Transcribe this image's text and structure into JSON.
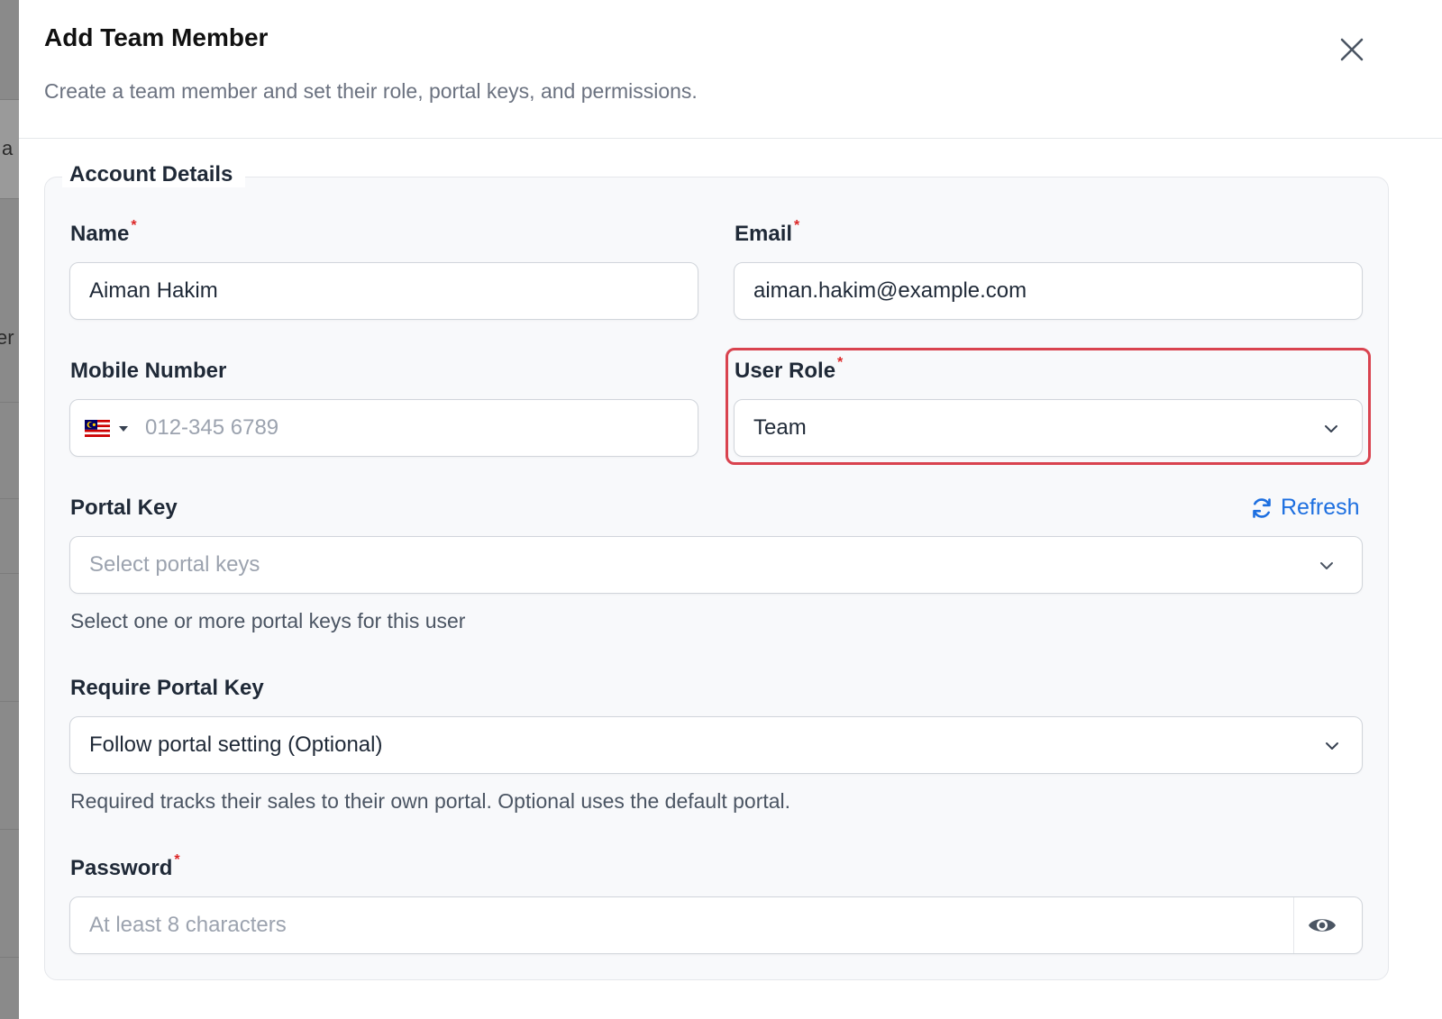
{
  "background": {
    "fragments": [
      "a",
      "er"
    ]
  },
  "modal": {
    "title": "Add Team Member",
    "subtitle": "Create a team member and set their role, portal keys, and permissions.",
    "close_icon": "close-icon"
  },
  "account_details": {
    "legend": "Account Details",
    "name": {
      "label": "Name",
      "required_mark": "*",
      "value": "Aiman Hakim"
    },
    "email": {
      "label": "Email",
      "required_mark": "*",
      "value": "aiman.hakim@example.com"
    },
    "mobile": {
      "label": "Mobile Number",
      "country_flag_icon": "malaysia-flag-icon",
      "placeholder": "012-345 6789"
    },
    "user_role": {
      "label": "User Role",
      "required_mark": "*",
      "selected": "Team",
      "highlight_color": "#d9434f"
    },
    "portal_key": {
      "label": "Portal Key",
      "refresh_label": "Refresh",
      "refresh_icon": "refresh-icon",
      "placeholder": "Select portal keys",
      "help": "Select one or more portal keys for this user"
    },
    "require_portal_key": {
      "label": "Require Portal Key",
      "selected": "Follow portal setting (Optional)",
      "help": "Required tracks their sales to their own portal. Optional uses the default portal."
    },
    "password": {
      "label": "Password",
      "required_mark": "*",
      "placeholder": "At least 8 characters",
      "toggle_icon": "eye-icon"
    }
  },
  "colors": {
    "accent": "#1d6fe0",
    "required": "#dc2626",
    "highlight": "#d9434f"
  }
}
